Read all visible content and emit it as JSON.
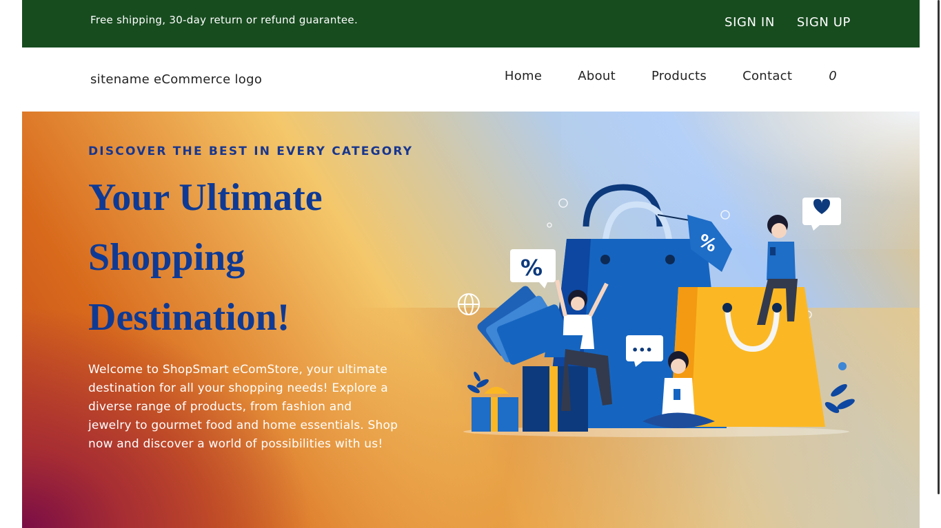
{
  "topbar": {
    "notice": "Free shipping, 30-day return or refund guarantee.",
    "sign_in": "SIGN IN",
    "sign_up": "SIGN UP"
  },
  "header": {
    "logo": "sitename eCommerce logo",
    "nav": {
      "home": "Home",
      "about": "About",
      "products": "Products",
      "contact": "Contact",
      "cart_count": "0"
    }
  },
  "hero": {
    "kicker": "DISCOVER THE BEST IN EVERY CATEGORY",
    "headline": "Your Ultimate Shopping Destination!",
    "intro": "Welcome to ShopSmart eComStore, your ultimate destination for all your shopping needs! Explore a diverse range of products, from fashion and jewelry to gourmet food and home essentials. Shop now and discover a world of possibilities with us!",
    "illustration": {
      "tag_text": "%",
      "bubble_percent": "%",
      "bubble_dots": "•••"
    }
  },
  "colors": {
    "topbar_bg": "#174c1f",
    "kicker": "#17368f",
    "headline": "#0e3a95",
    "bag_blue": "#1565c0",
    "bag_yellow": "#f9a825"
  }
}
